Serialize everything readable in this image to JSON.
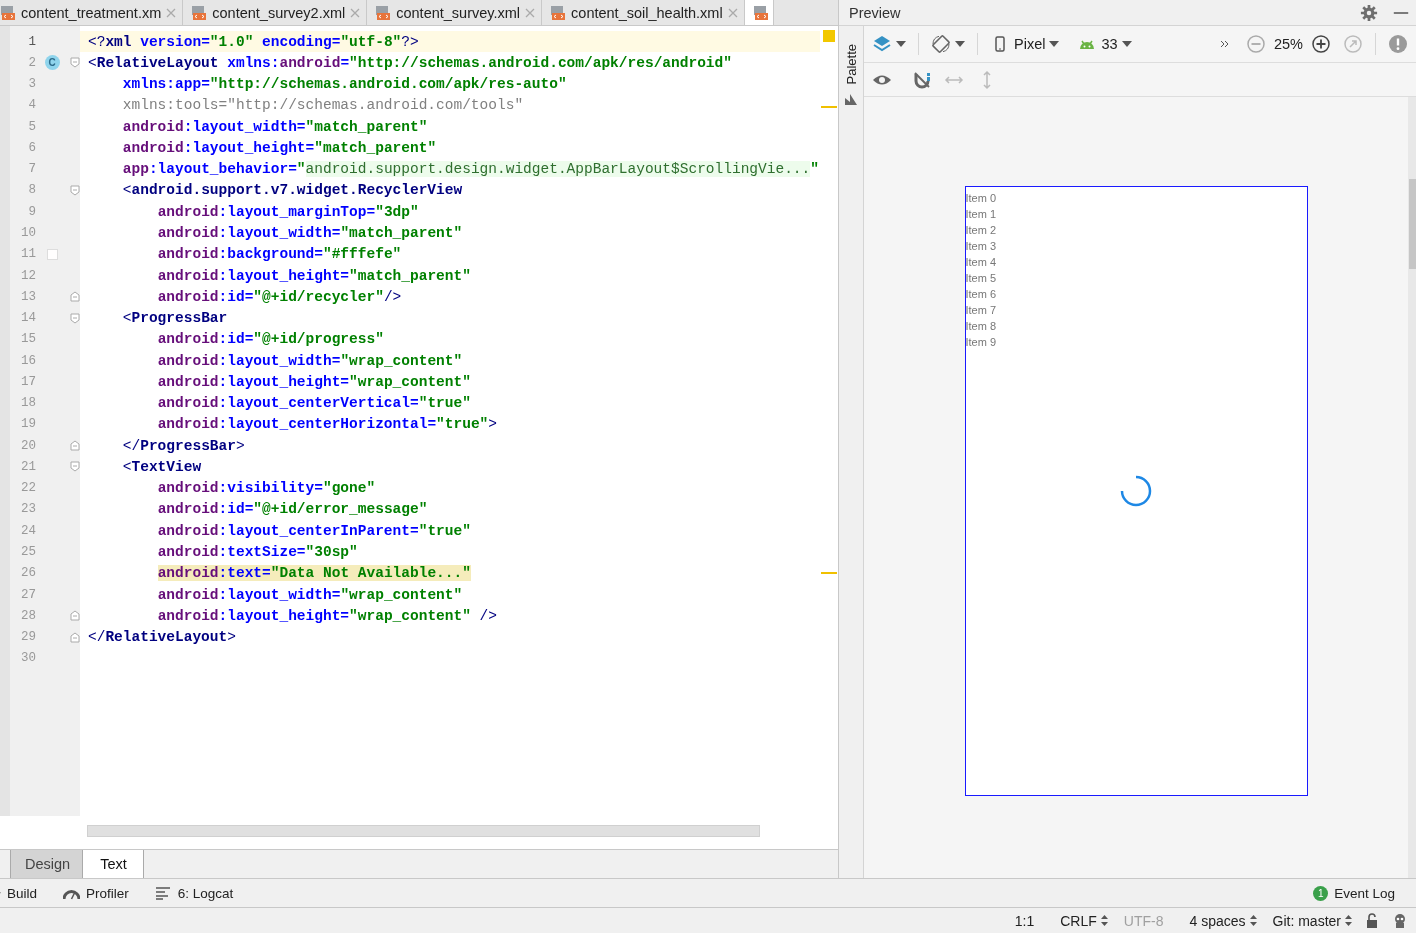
{
  "editor_tabs": [
    {
      "label": "content_treatment.xm",
      "selected": false
    },
    {
      "label": "content_survey2.xml",
      "selected": false
    },
    {
      "label": "content_survey.xml",
      "selected": false
    },
    {
      "label": "content_soil_health.xml",
      "selected": false
    },
    {
      "selected": true
    }
  ],
  "code_lines": [
    {
      "number": "1",
      "current": true,
      "highlighted": false,
      "segments": [
        {
          "kind": "punct",
          "text": "<?"
        },
        {
          "kind": "tag",
          "text": "xml"
        },
        {
          "kind": "attr",
          "text": " version="
        },
        {
          "kind": "value",
          "text": "\"1.0\""
        },
        {
          "kind": "attr",
          "text": " encoding="
        },
        {
          "kind": "value",
          "text": "\"utf-8\""
        },
        {
          "kind": "punct",
          "text": "?>"
        }
      ]
    },
    {
      "number": "2",
      "current": false,
      "highlighted": false,
      "badge": "C",
      "fold_start": true,
      "segments": [
        {
          "kind": "punct",
          "text": "<"
        },
        {
          "kind": "tag",
          "text": "RelativeLayout"
        },
        {
          "kind": "attr",
          "text": " xmlns:"
        },
        {
          "kind": "ns",
          "text": "android"
        },
        {
          "kind": "attr",
          "text": "="
        },
        {
          "kind": "value",
          "text": "\"http://schemas.android.com/apk/res/android\""
        }
      ],
      "children": [
        {
          "number": "3",
          "current": false,
          "highlighted": false,
          "segments": [
            {
              "kind": "attr",
              "text": "xmlns:app="
            },
            {
              "kind": "value",
              "text": "\"http://schemas.android.com/apk/res-auto\""
            }
          ]
        },
        {
          "number": "4",
          "current": false,
          "highlighted": false,
          "segments": [
            {
              "kind": "unused",
              "text": "xmlns:tools=\"http://schemas.android.com/tools\""
            }
          ]
        },
        {
          "number": "5",
          "current": false,
          "highlighted": false,
          "segments": [
            {
              "kind": "ns",
              "text": "android"
            },
            {
              "kind": "attr",
              "text": ":layout_width="
            },
            {
              "kind": "value",
              "text": "\"match_parent\""
            }
          ]
        },
        {
          "number": "6",
          "current": false,
          "highlighted": false,
          "segments": [
            {
              "kind": "ns",
              "text": "android"
            },
            {
              "kind": "attr",
              "text": ":layout_height="
            },
            {
              "kind": "value",
              "text": "\"match_parent\""
            }
          ]
        },
        {
          "number": "7",
          "current": false,
          "highlighted": false,
          "segments": [
            {
              "kind": "ns",
              "text": "app"
            },
            {
              "kind": "attr",
              "text": ":layout_behavior="
            },
            {
              "kind": "value",
              "text": "\""
            },
            {
              "kind": "injected",
              "text": "android.support.design.widget.AppBarLayout$ScrollingVie..."
            },
            {
              "kind": "value",
              "text": "\""
            }
          ]
        },
        {
          "number": "8",
          "current": false,
          "highlighted": false,
          "fold_start": true,
          "segments": [
            {
              "kind": "punct",
              "text": "<"
            },
            {
              "kind": "tag",
              "text": "android.support.v7.widget.RecyclerView"
            }
          ],
          "children": [
            {
              "number": "9",
              "current": false,
              "highlighted": false,
              "segments": [
                {
                  "kind": "ns",
                  "text": "android"
                },
                {
                  "kind": "attr",
                  "text": ":layout_marginTop="
                },
                {
                  "kind": "value",
                  "text": "\"3dp\""
                }
              ]
            },
            {
              "number": "10",
              "current": false,
              "highlighted": false,
              "segments": [
                {
                  "kind": "ns",
                  "text": "android"
                },
                {
                  "kind": "attr",
                  "text": ":layout_width="
                },
                {
                  "kind": "value",
                  "text": "\"match_parent\""
                }
              ]
            },
            {
              "number": "11",
              "current": false,
              "highlighted": false,
              "color": "#fffefe",
              "segments": [
                {
                  "kind": "ns",
                  "text": "android"
                },
                {
                  "kind": "attr",
                  "text": ":background="
                },
                {
                  "kind": "value",
                  "text": "\"#fffefe\""
                }
              ]
            },
            {
              "number": "12",
              "current": false,
              "highlighted": false,
              "segments": [
                {
                  "kind": "ns",
                  "text": "android"
                },
                {
                  "kind": "attr",
                  "text": ":layout_height="
                },
                {
                  "kind": "value",
                  "text": "\"match_parent\""
                }
              ]
            },
            {
              "number": "13",
              "current": false,
              "highlighted": false,
              "fold_end": true,
              "segments": [
                {
                  "kind": "ns",
                  "text": "android"
                },
                {
                  "kind": "attr",
                  "text": ":id="
                },
                {
                  "kind": "value",
                  "text": "\"@+id/recycler\""
                },
                {
                  "kind": "punct",
                  "text": "/>"
                }
              ]
            }
          ]
        },
        {
          "number": "14",
          "current": false,
          "highlighted": false,
          "fold_start": true,
          "segments": [
            {
              "kind": "punct",
              "text": "<"
            },
            {
              "kind": "tag",
              "text": "ProgressBar"
            }
          ],
          "children": [
            {
              "number": "15",
              "current": false,
              "highlighted": false,
              "segments": [
                {
                  "kind": "ns",
                  "text": "android"
                },
                {
                  "kind": "attr",
                  "text": ":id="
                },
                {
                  "kind": "value",
                  "text": "\"@+id/progress\""
                }
              ]
            },
            {
              "number": "16",
              "current": false,
              "highlighted": false,
              "segments": [
                {
                  "kind": "ns",
                  "text": "android"
                },
                {
                  "kind": "attr",
                  "text": ":layout_width="
                },
                {
                  "kind": "value",
                  "text": "\"wrap_content\""
                }
              ]
            },
            {
              "number": "17",
              "current": false,
              "highlighted": false,
              "segments": [
                {
                  "kind": "ns",
                  "text": "android"
                },
                {
                  "kind": "attr",
                  "text": ":layout_height="
                },
                {
                  "kind": "value",
                  "text": "\"wrap_content\""
                }
              ]
            },
            {
              "number": "18",
              "current": false,
              "highlighted": false,
              "segments": [
                {
                  "kind": "ns",
                  "text": "android"
                },
                {
                  "kind": "attr",
                  "text": ":layout_centerVertical="
                },
                {
                  "kind": "value",
                  "text": "\"true\""
                }
              ]
            },
            {
              "number": "19",
              "current": false,
              "highlighted": false,
              "segments": [
                {
                  "kind": "ns",
                  "text": "android"
                },
                {
                  "kind": "attr",
                  "text": ":layout_centerHorizontal="
                },
                {
                  "kind": "value",
                  "text": "\"true\""
                },
                {
                  "kind": "punct",
                  "text": ">"
                }
              ]
            }
          ]
        },
        {
          "number": "20",
          "current": false,
          "highlighted": false,
          "fold_end": true,
          "segments": [
            {
              "kind": "punct",
              "text": "</"
            },
            {
              "kind": "tag",
              "text": "ProgressBar"
            },
            {
              "kind": "punct",
              "text": ">"
            }
          ]
        },
        {
          "number": "21",
          "current": false,
          "highlighted": false,
          "fold_start": true,
          "segments": [
            {
              "kind": "punct",
              "text": "<"
            },
            {
              "kind": "tag",
              "text": "TextView"
            }
          ],
          "children": [
            {
              "number": "22",
              "current": false,
              "highlighted": false,
              "segments": [
                {
                  "kind": "ns",
                  "text": "android"
                },
                {
                  "kind": "attr",
                  "text": ":visibility="
                },
                {
                  "kind": "value",
                  "text": "\"gone\""
                }
              ]
            },
            {
              "number": "23",
              "current": false,
              "highlighted": false,
              "segments": [
                {
                  "kind": "ns",
                  "text": "android"
                },
                {
                  "kind": "attr",
                  "text": ":id="
                },
                {
                  "kind": "value",
                  "text": "\"@+id/error_message\""
                }
              ]
            },
            {
              "number": "24",
              "current": false,
              "highlighted": false,
              "segments": [
                {
                  "kind": "ns",
                  "text": "android"
                },
                {
                  "kind": "attr",
                  "text": ":layout_centerInParent="
                },
                {
                  "kind": "value",
                  "text": "\"true\""
                }
              ]
            },
            {
              "number": "25",
              "current": false,
              "highlighted": false,
              "segments": [
                {
                  "kind": "ns",
                  "text": "android"
                },
                {
                  "kind": "attr",
                  "text": ":textSize="
                },
                {
                  "kind": "value",
                  "text": "\"30sp\""
                }
              ]
            },
            {
              "number": "26",
              "current": false,
              "highlighted": true,
              "segments": [
                {
                  "kind": "ns",
                  "text": "android"
                },
                {
                  "kind": "attr",
                  "text": ":text="
                },
                {
                  "kind": "value",
                  "text": "\"Data Not Available...\""
                }
              ]
            },
            {
              "number": "27",
              "current": false,
              "highlighted": false,
              "segments": [
                {
                  "kind": "ns",
                  "text": "android"
                },
                {
                  "kind": "attr",
                  "text": ":layout_width="
                },
                {
                  "kind": "value",
                  "text": "\"wrap_content\""
                }
              ]
            },
            {
              "number": "28",
              "current": false,
              "highlighted": false,
              "fold_end": true,
              "segments": [
                {
                  "kind": "ns",
                  "text": "android"
                },
                {
                  "kind": "attr",
                  "text": ":layout_height="
                },
                {
                  "kind": "value",
                  "text": "\"wrap_content\""
                },
                {
                  "kind": "punct",
                  "text": " />"
                }
              ]
            }
          ]
        }
      ]
    },
    {
      "number": "29",
      "current": false,
      "highlighted": false,
      "fold_end": true,
      "segments": [
        {
          "kind": "punct",
          "text": "</"
        },
        {
          "kind": "tag",
          "text": "RelativeLayout"
        },
        {
          "kind": "punct",
          "text": ">"
        }
      ]
    },
    {
      "number": "30",
      "current": false,
      "highlighted": false
    }
  ],
  "editor_mode_tabs": [
    {
      "label": "Design",
      "selected": false
    },
    {
      "label": "Text",
      "selected": true
    }
  ],
  "preview": {
    "title": "Preview",
    "palette_label": "Palette",
    "device": "Pixel",
    "api_level": "33",
    "zoom": "25%",
    "list_items": [
      "Item 0",
      "Item 1",
      "Item 2",
      "Item 3",
      "Item 4",
      "Item 5",
      "Item 6",
      "Item 7",
      "Item 8",
      "Item 9"
    ]
  },
  "tool_windows": [
    {
      "kind": "build",
      "label": "Build"
    },
    {
      "kind": "profiler",
      "label": "Profiler"
    },
    {
      "kind": "logcat",
      "label": "6: Logcat"
    }
  ],
  "event_log": {
    "label": "Event Log",
    "badge": "1"
  },
  "status_bar": [
    {
      "text": "1:1",
      "dropdown": false,
      "disabled": false
    },
    {
      "text": "CRLF",
      "dropdown": true,
      "disabled": false
    },
    {
      "text": "UTF-8",
      "dropdown": false,
      "disabled": true
    },
    {
      "text": "4 spaces",
      "dropdown": true,
      "disabled": false
    },
    {
      "text": "Git: master",
      "dropdown": true,
      "disabled": false
    }
  ]
}
